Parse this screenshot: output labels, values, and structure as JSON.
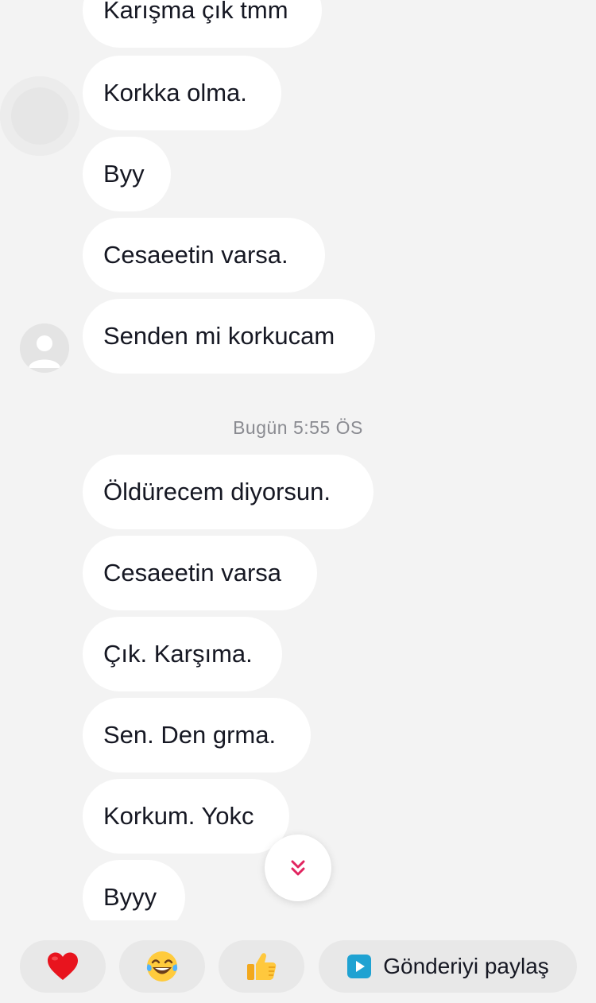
{
  "messages_before": [
    "Karışma çık tmm",
    "Korkka olma.",
    "Byy",
    "Cesaeetin varsa.",
    "Senden mi korkucam"
  ],
  "timestamp": "Bugün 5:55 ÖS",
  "messages_after": [
    "Öldürecem diyorsun.",
    "Cesaeetin varsa",
    "Çık. Karşıma.",
    "Sen. Den grma.",
    "Korkum. Yokc",
    "Byyy"
  ],
  "quick_reactions": [
    {
      "name": "heart",
      "icon": "heart-icon"
    },
    {
      "name": "laugh",
      "icon": "tears-of-joy-icon"
    },
    {
      "name": "thumbs-up",
      "icon": "thumbs-up-icon"
    }
  ],
  "share": {
    "label": "Gönderiyi paylaş",
    "icon": "play-icon",
    "icon_color": "#1fa2d2"
  },
  "scroll_down": {
    "icon": "double-chevron-down-icon",
    "color": "#e1245f"
  },
  "colors": {
    "background": "#f3f3f3",
    "bubble": "#ffffff",
    "text": "#161823",
    "timestamp": "#8a8b91",
    "button": "#e8e8e8"
  }
}
